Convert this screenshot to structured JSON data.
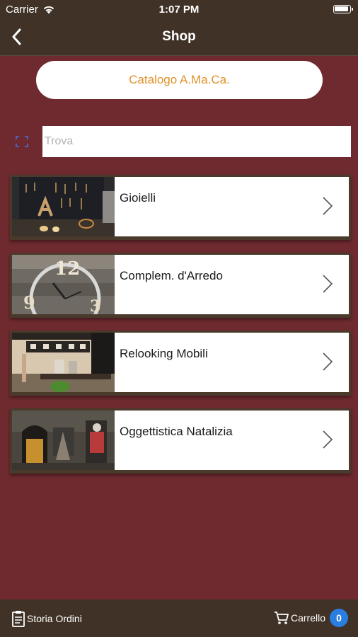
{
  "status_bar": {
    "carrier": "Carrier",
    "time": "1:07 PM"
  },
  "nav": {
    "title": "Shop"
  },
  "catalog_button": {
    "label": "Catalogo A.Ma.Ca."
  },
  "search": {
    "placeholder": "Trova",
    "value": ""
  },
  "categories": [
    {
      "label": "Gioielli"
    },
    {
      "label": "Complem. d'Arredo"
    },
    {
      "label": "Relooking Mobili"
    },
    {
      "label": "Oggettistica Natalizia"
    }
  ],
  "tabbar": {
    "orders_label": "Storia Ordini",
    "cart_label": "Carrello",
    "cart_count": "0"
  },
  "colors": {
    "background": "#6e2a2f",
    "bars": "#403226",
    "accent": "#e0922b",
    "badge": "#2a7de1"
  }
}
